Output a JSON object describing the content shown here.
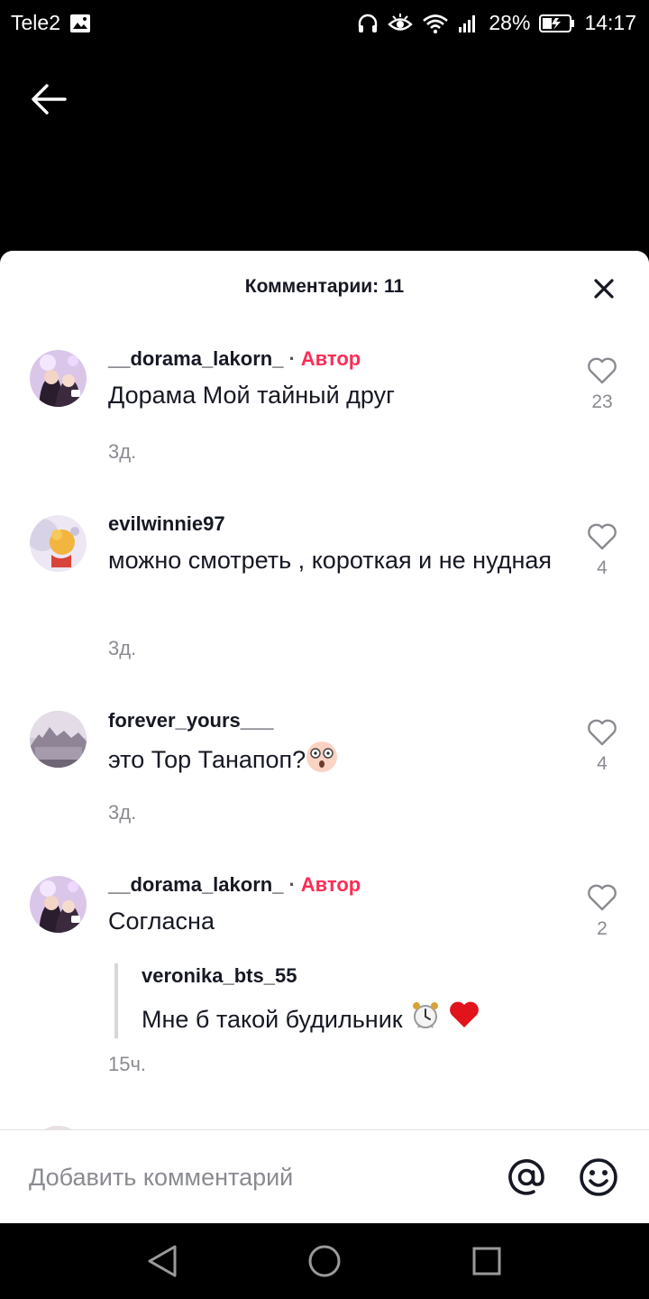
{
  "status_bar": {
    "carrier": "Tele2",
    "battery": "28%",
    "time": "14:17"
  },
  "sheet": {
    "title": "Комментарии: 11"
  },
  "comments": [
    {
      "username": "__dorama_lakorn_",
      "author_label": "Автор",
      "separator": "·",
      "text": "Дорама Мой тайный друг",
      "time": "3д.",
      "likes": "23"
    },
    {
      "username": "evilwinnie97",
      "text": "можно смотреть , короткая и не нудная",
      "time": "3д.",
      "likes": "4"
    },
    {
      "username": "forever_yours___",
      "text": "это Тор Танапоп?",
      "time": "3д.",
      "likes": "4"
    },
    {
      "username": "__dorama_lakorn_",
      "author_label": "Автор",
      "separator": "·",
      "text": "Согласна",
      "reply": {
        "username": "veronika_bts_55",
        "text": "Мне б такой будильник"
      },
      "time": "15ч.",
      "likes": "2"
    }
  ],
  "input": {
    "placeholder": "Добавить комментарий"
  },
  "colors": {
    "accent": "#fe2c55",
    "muted": "#8a8b91",
    "text": "#161823"
  }
}
